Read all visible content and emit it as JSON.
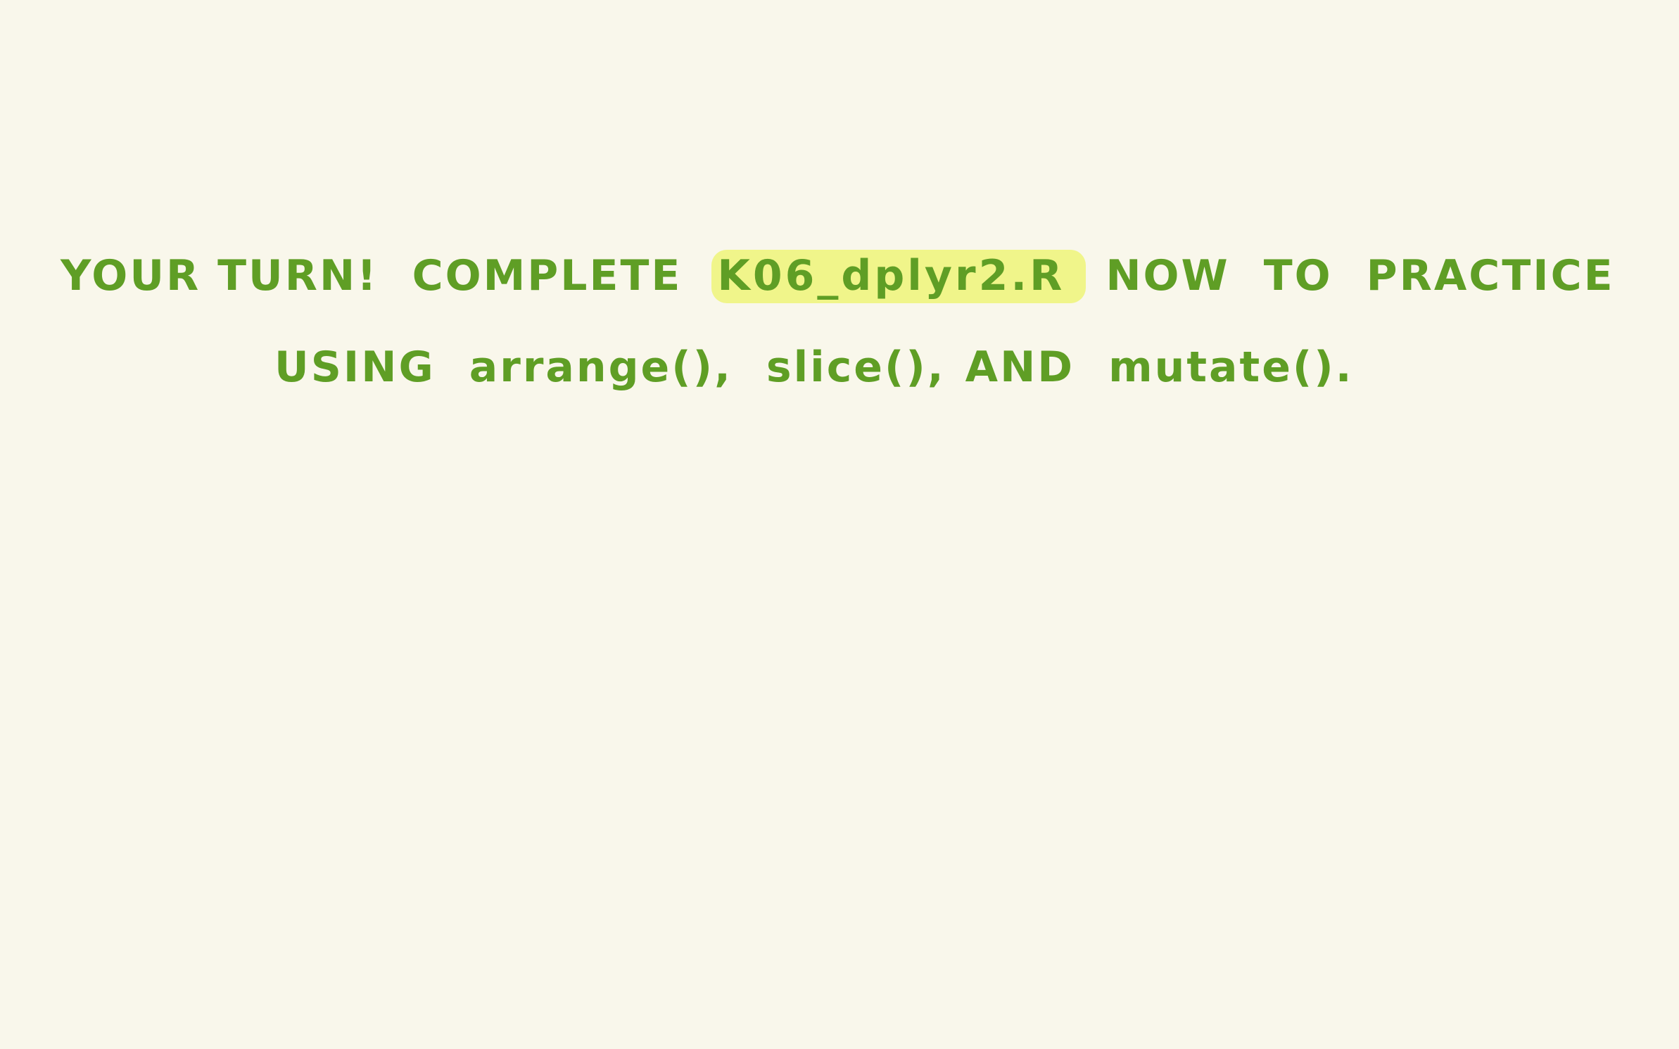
{
  "colors": {
    "background": "#f9f7eb",
    "ink": "#5f9e25",
    "highlight": "#f0f58a"
  },
  "line1": {
    "your_turn": "YOUR TURN!",
    "complete": "COMPLETE",
    "filename": "K06_dplyr2.R",
    "now": "NOW",
    "to": "TO",
    "practice": "PRACTICE"
  },
  "line2": {
    "using": "USING",
    "arrange": "arrange(),",
    "slice": "slice(),",
    "and": "AND",
    "mutate": "mutate()."
  }
}
